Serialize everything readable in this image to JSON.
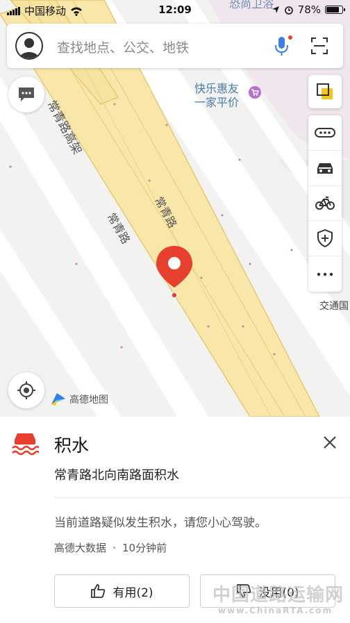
{
  "status_bar": {
    "carrier": "中国移动",
    "time": "12:09",
    "battery": "78%"
  },
  "search": {
    "placeholder": "查找地点、公交、地铁"
  },
  "map": {
    "poi_line1": "快乐惠友",
    "poi_line2": "一家平价",
    "road_elevated": "常青路高架",
    "road_main": "常青路",
    "road_side": "常青路",
    "top_label": "恐尚卫浴",
    "traffic_label": "交通国",
    "brand": "高德地图"
  },
  "incident": {
    "title": "积水",
    "subtitle": "常青路北向南路面积水",
    "description": "当前道路疑似发生积水，请您小心驾驶。",
    "source": "高德大数据",
    "time_ago": "10分钟前",
    "useful_label": "有用(2)",
    "useless_label": "没用(0)"
  },
  "watermark": {
    "cn": "中国道路运输网",
    "en": "www.ChinaRTA.com"
  },
  "colors": {
    "accent_blue": "#3b7ee8",
    "incident_red": "#e8402e",
    "road_yellow": "#f9e7a9",
    "road_edge": "#e8c872"
  },
  "icons": {
    "avatar": "user-avatar-icon",
    "mic": "microphone-icon",
    "scan": "scan-icon",
    "chat": "message-icon",
    "layers": "layers-icon",
    "bus": "transit-icon",
    "taxi": "taxi-icon",
    "bike": "bicycle-icon",
    "safety": "shield-icon",
    "more": "more-icon",
    "locate": "locate-icon",
    "close": "close-icon",
    "thumb_up": "thumb-up-icon",
    "thumb_down": "thumb-down-icon",
    "water": "waterlogging-icon",
    "pin": "location-pin-icon"
  }
}
